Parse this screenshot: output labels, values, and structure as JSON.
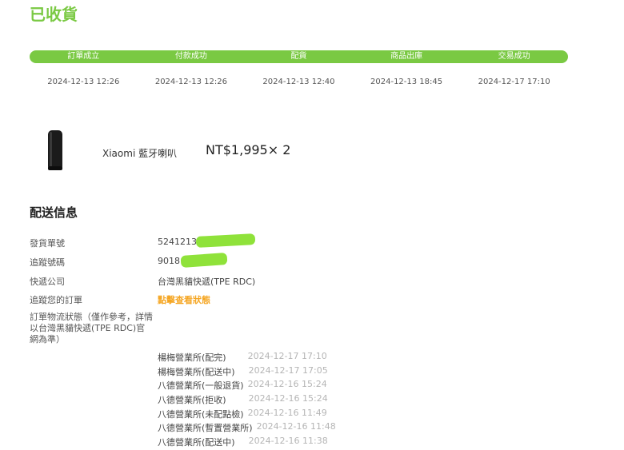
{
  "order": {
    "status_title": "已收貨",
    "steps": [
      {
        "label": "訂單成立",
        "time": "2024-12-13 12:26"
      },
      {
        "label": "付款成功",
        "time": "2024-12-13 12:26"
      },
      {
        "label": "配貨",
        "time": "2024-12-13 12:40"
      },
      {
        "label": "商品出庫",
        "time": "2024-12-13 18:45"
      },
      {
        "label": "交易成功",
        "time": "2024-12-17 17:10"
      }
    ],
    "progress_color": "#7ac943"
  },
  "product": {
    "name": "Xiaomi 藍牙喇叭",
    "price": "NT$1,995× 2",
    "image_icon": "speaker-image"
  },
  "shipping": {
    "section_title": "配送信息",
    "invoice_label": "發貨單號",
    "invoice_value": "52412138",
    "tracking_label": "追蹤號碼",
    "tracking_value": "9018",
    "courier_label": "快遞公司",
    "courier_value": "台灣黑貓快遞(TPE RDC)",
    "track_label": "追蹤您的訂單",
    "track_link": "點擊查看狀態",
    "logistics_label": "訂單物流狀態（僅作參考，詳情以台灣黑貓快遞(TPE RDC)官網為準）",
    "link_color": "#f5a623",
    "events": [
      {
        "location": "楊梅營業所(配完)",
        "time": "2024-12-17 17:10"
      },
      {
        "location": "楊梅營業所(配送中)",
        "time": "2024-12-17 17:05"
      },
      {
        "location": "八德營業所(一般退貨)",
        "time": "2024-12-16 15:24"
      },
      {
        "location": "八德營業所(拒收)",
        "time": "2024-12-16 15:24"
      },
      {
        "location": "八德營業所(未配點檢)",
        "time": "2024-12-16 11:49"
      },
      {
        "location": "八德營業所(暫置營業所)",
        "time": "2024-12-16 11:48"
      },
      {
        "location": "八德營業所(配送中)",
        "time": "2024-12-16 11:38"
      }
    ]
  }
}
